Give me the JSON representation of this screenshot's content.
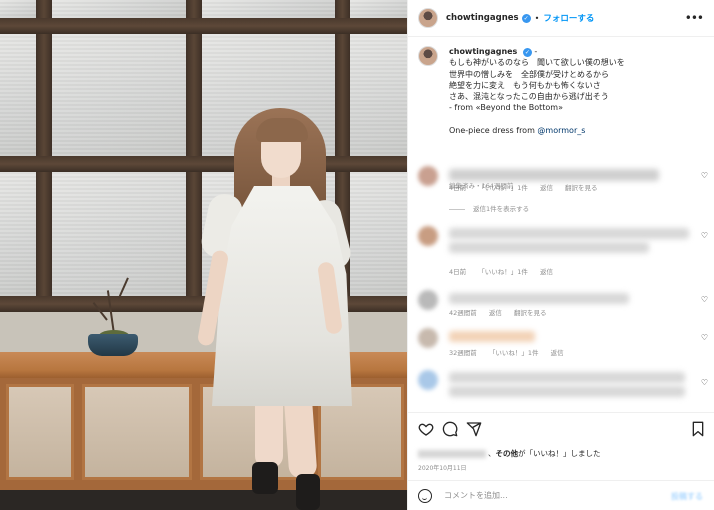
{
  "header": {
    "username": "chowtingagnes",
    "verified_mark": "✓",
    "separator": "•",
    "follow_label": "フォローする",
    "more_label": "•••"
  },
  "caption": {
    "username": "chowtingagnes",
    "dash": "-",
    "lines": [
      "もしも神がいるのなら　聞いて欲しい僕の想いを",
      "世界中の憎しみを　全部僕が受けとめるから",
      "絶望を力に変え　もう何もかも怖くないさ",
      "さあ、混沌となったこの自由から逃げ出そう",
      "- from «Beyond the Bottom»"
    ],
    "dress_prefix": "One-piece dress from ",
    "dress_mention": "@mormor_s",
    "meta": "編集済み・164週間前"
  },
  "comments": [
    {
      "time": "4日前",
      "likes": "「いいね！」1件",
      "reply": "返信",
      "translate": "翻訳を見る",
      "view_replies": "返信1件を表示する"
    },
    {
      "time": "4日前",
      "likes": "「いいね！」1件",
      "reply": "返信"
    },
    {
      "time": "42週間前",
      "reply": "返信",
      "translate": "翻訳を見る"
    },
    {
      "time": "32週間前",
      "likes": "「いいね！」1件",
      "reply": "返信"
    }
  ],
  "actions": {
    "like_icon": "heart-icon",
    "comment_icon": "comment-icon",
    "share_icon": "share-icon",
    "save_icon": "bookmark-icon",
    "likes_text_bold": "その他",
    "likes_text_rest": "が「いいね！」しました",
    "likes_separator": "、",
    "date": "2020年10月11日"
  },
  "add_comment": {
    "placeholder": "コメントを追加...",
    "post_label": "投稿する"
  },
  "colors": {
    "accent": "#0095f6",
    "verified": "#3897f0",
    "text": "#262626",
    "muted": "#8e8e8e"
  }
}
